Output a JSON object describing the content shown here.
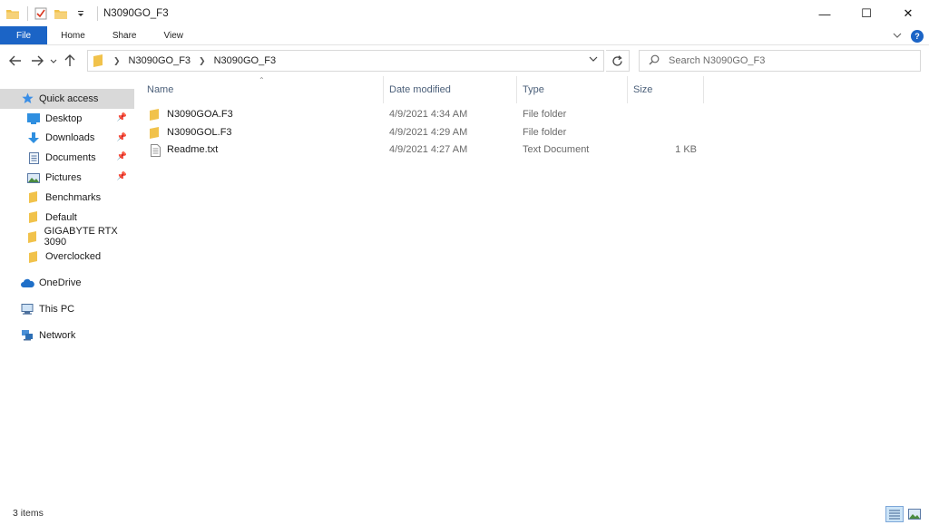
{
  "window": {
    "title": "N3090GO_F3",
    "controls": {
      "minimize": "—",
      "maximize": "☐",
      "close": "✕"
    }
  },
  "ribbon": {
    "tabs": [
      "File",
      "Home",
      "Share",
      "View"
    ]
  },
  "address": {
    "crumbs": [
      "N3090GO_F3",
      "N3090GO_F3"
    ]
  },
  "search": {
    "placeholder": "Search N3090GO_F3"
  },
  "columns": {
    "name": "Name",
    "date": "Date modified",
    "type": "Type",
    "size": "Size"
  },
  "files": [
    {
      "name": "N3090GOA.F3",
      "date": "4/9/2021 4:34 AM",
      "type": "File folder",
      "size": "",
      "icon": "folder-icon"
    },
    {
      "name": "N3090GOL.F3",
      "date": "4/9/2021 4:29 AM",
      "type": "File folder",
      "size": "",
      "icon": "folder-icon"
    },
    {
      "name": "Readme.txt",
      "date": "4/9/2021 4:27 AM",
      "type": "Text Document",
      "size": "1 KB",
      "icon": "text-file-icon"
    }
  ],
  "sidebar": {
    "quick_access": "Quick access",
    "items": [
      {
        "label": "Desktop",
        "icon": "desktop-icon",
        "pinned": true
      },
      {
        "label": "Downloads",
        "icon": "downloads-icon",
        "pinned": true
      },
      {
        "label": "Documents",
        "icon": "documents-icon",
        "pinned": true
      },
      {
        "label": "Pictures",
        "icon": "pictures-icon",
        "pinned": true
      },
      {
        "label": "Benchmarks",
        "icon": "folder-icon",
        "pinned": false
      },
      {
        "label": "Default",
        "icon": "folder-icon",
        "pinned": false
      },
      {
        "label": "GIGABYTE RTX 3090",
        "icon": "folder-icon",
        "pinned": false
      },
      {
        "label": "Overclocked",
        "icon": "folder-icon",
        "pinned": false
      }
    ],
    "onedrive": "OneDrive",
    "this_pc": "This PC",
    "network": "Network"
  },
  "status": {
    "item_count": "3 items"
  },
  "colors": {
    "accent": "#1b64c6",
    "folder": "#f1c24b",
    "selected_bg": "#d9d9d9"
  }
}
